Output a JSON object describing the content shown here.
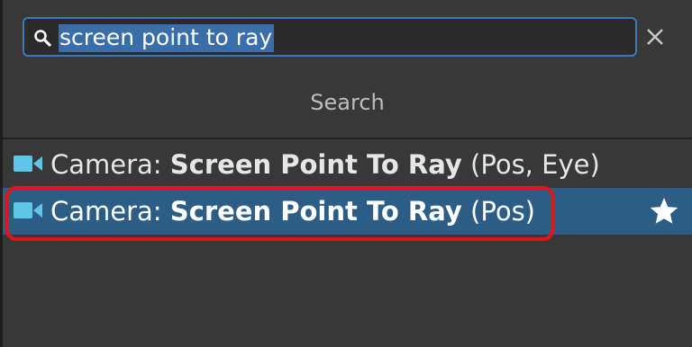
{
  "search": {
    "value": "screen point to ray"
  },
  "clear_symbol": "✕",
  "header": {
    "title": "Search"
  },
  "results": [
    {
      "prefix": "Camera: ",
      "name": "Screen Point To Ray",
      "suffix": " (Pos, Eye)",
      "selected": false,
      "icon": "camera-icon"
    },
    {
      "prefix": "Camera: ",
      "name": "Screen Point To Ray",
      "suffix": " (Pos)",
      "selected": true,
      "icon": "camera-icon",
      "favorite_icon": "star-icon"
    }
  ],
  "colors": {
    "background": "#383838",
    "selection": "#2c5d87",
    "camera_icon": "#5fc6e8",
    "highlight_box": "#e0141c",
    "search_border": "#3a79bb"
  }
}
